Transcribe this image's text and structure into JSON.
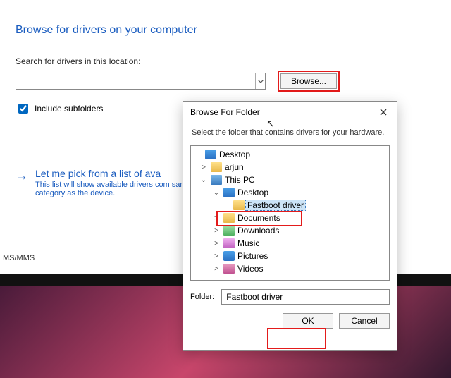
{
  "wizard": {
    "title": "Browse for drivers on your computer",
    "label": "Search for drivers in this location:",
    "path": "",
    "browse": "Browse...",
    "include_subfolders": "Include subfolders",
    "option_title": "Let me pick from a list of ava",
    "option_desc": "This list will show available drivers com same category as the device."
  },
  "bg": {
    "strip": "MS/MMS"
  },
  "dialog": {
    "title": "Browse For Folder",
    "hint": "Select the folder that contains drivers for your hardware.",
    "folder_label": "Folder:",
    "folder_value": "Fastboot driver",
    "ok": "OK",
    "cancel": "Cancel",
    "tree": {
      "desktop": "Desktop",
      "arjun": "arjun",
      "thispc": "This PC",
      "pc_desktop": "Desktop",
      "fastboot": "Fastboot driver",
      "documents": "Documents",
      "downloads": "Downloads",
      "music": "Music",
      "pictures": "Pictures",
      "videos": "Videos"
    }
  }
}
